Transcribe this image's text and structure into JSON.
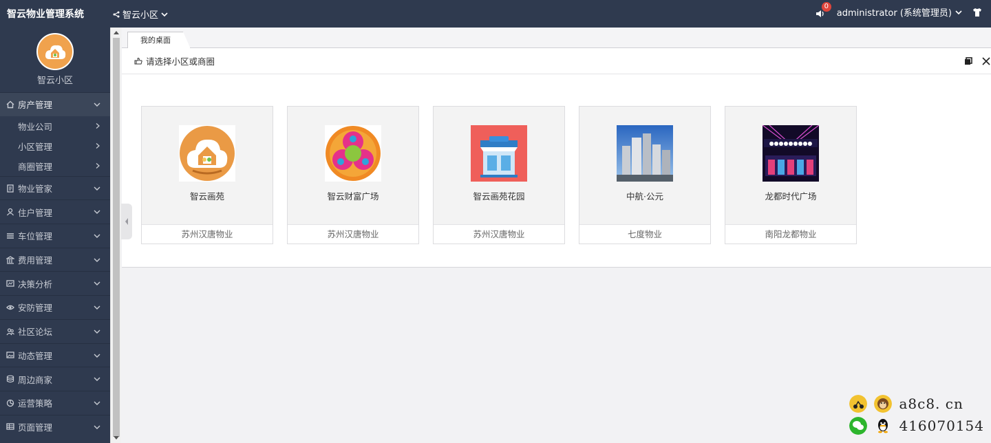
{
  "app": {
    "title": "智云物业管理系统"
  },
  "header": {
    "community": "智云小区",
    "notification_count": "0",
    "user": "administrator (系统管理员)"
  },
  "sidebar": {
    "profile_name": "智云小区",
    "menu": [
      {
        "label": "房产管理",
        "icon": "home-icon",
        "open": true,
        "children": [
          {
            "label": "物业公司"
          },
          {
            "label": "小区管理"
          },
          {
            "label": "商圈管理"
          }
        ]
      },
      {
        "label": "物业管家",
        "icon": "file-icon"
      },
      {
        "label": "住户管理",
        "icon": "user-icon"
      },
      {
        "label": "车位管理",
        "icon": "list-icon"
      },
      {
        "label": "费用管理",
        "icon": "bank-icon"
      },
      {
        "label": "决策分析",
        "icon": "chart-icon"
      },
      {
        "label": "安防管理",
        "icon": "eye-icon"
      },
      {
        "label": "社区论坛",
        "icon": "users-icon"
      },
      {
        "label": "动态管理",
        "icon": "image-icon"
      },
      {
        "label": "周边商家",
        "icon": "database-icon"
      },
      {
        "label": "运营策略",
        "icon": "pie-icon"
      },
      {
        "label": "页面管理",
        "icon": "table-icon"
      }
    ]
  },
  "tabs": [
    {
      "label": "我的桌面"
    }
  ],
  "panel": {
    "title": "请选择小区或商圈",
    "cards": [
      {
        "name": "智云画苑",
        "company": "苏州汉唐物业",
        "icon": "house-cloud-logo"
      },
      {
        "name": "智云财富广场",
        "company": "苏州汉唐物业",
        "icon": "flower-logo"
      },
      {
        "name": "智云画苑花园",
        "company": "苏州汉唐物业",
        "icon": "store-logo"
      },
      {
        "name": "中航·公元",
        "company": "七度物业",
        "icon": "buildings-photo"
      },
      {
        "name": "龙都时代广场",
        "company": "南阳龙都物业",
        "icon": "night-plaza-photo"
      }
    ]
  },
  "watermark": {
    "site": "a8c8. cn",
    "qq": "416070154"
  },
  "colors": {
    "sidebar": "#2f3a4f",
    "accent_orange": "#f0a24d",
    "badge_red": "#e0453b"
  }
}
